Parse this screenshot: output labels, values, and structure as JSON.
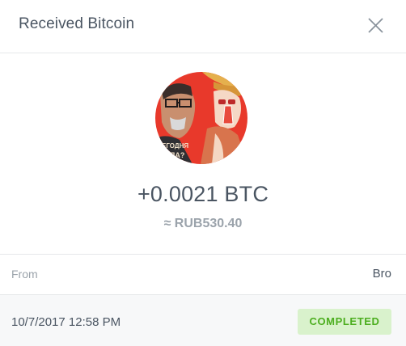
{
  "header": {
    "title": "Received Bitcoin",
    "close_icon": "close-icon"
  },
  "transaction": {
    "amount": "+0.0021 BTC",
    "fiat_amount": "≈ RUB530.40",
    "from_label": "From",
    "from_value": "Bro",
    "datetime": "10/7/2017 12:58 PM",
    "status": "COMPLETED"
  },
  "colors": {
    "text": "#4a5562",
    "muted": "#9ba3ab",
    "status_bg": "#d9f2cc",
    "status_fg": "#4cae1f"
  }
}
